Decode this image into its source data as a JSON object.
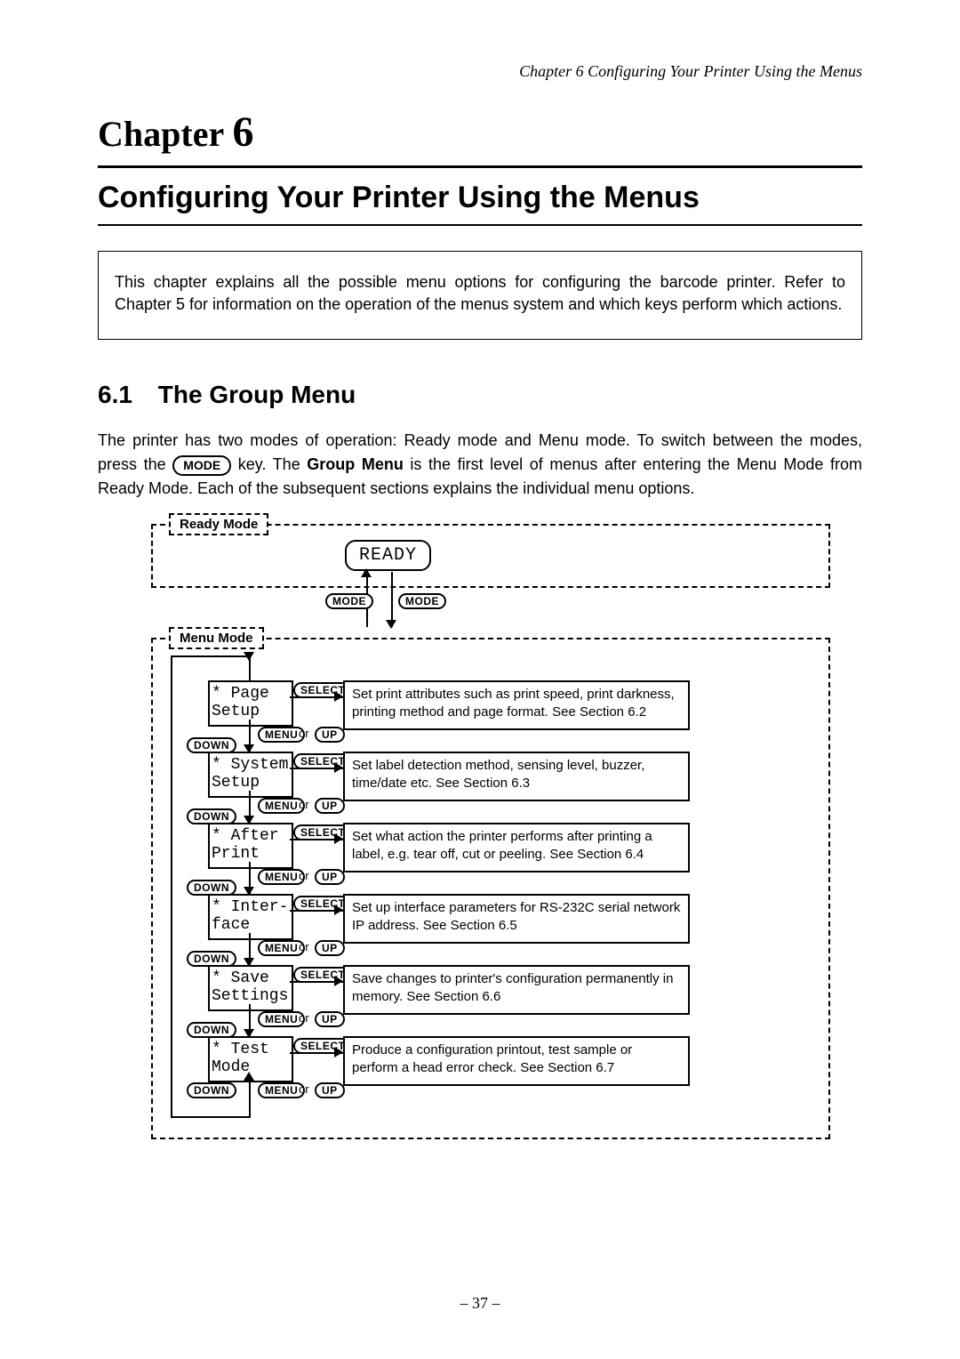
{
  "header": {
    "running_head": "Chapter 6   Configuring Your Printer Using the Menus"
  },
  "chapter": {
    "label": "Chapter",
    "number": "6",
    "title": "Configuring Your Printer Using the Menus"
  },
  "intro": {
    "text": "This chapter explains all the possible menu options for configuring the barcode printer. Refer to Chapter 5 for information on the operation of the menus system and which keys perform which actions."
  },
  "section": {
    "number": "6.1",
    "title": "The Group Menu",
    "para_a": "The printer has two modes of operation: Ready mode and Menu mode. To switch between the modes, press the ",
    "para_b_key": "MODE",
    "para_c": " key. The ",
    "para_d_bold": "Group Menu",
    "para_e": " is the first level of menus after entering the Menu Mode from Ready Mode. Each of the subsequent sections explains the individual menu options."
  },
  "diagram": {
    "ready_mode_label": "Ready Mode",
    "menu_mode_label": "Menu Mode",
    "ready_display": "READY",
    "keys": {
      "mode": "MODE",
      "select": "SELECT",
      "menu": "MENU",
      "up": "UP",
      "down": "DOWN",
      "or": "or"
    },
    "items": [
      {
        "name": "* Page Setup",
        "desc": "Set print attributes such as print speed, print darkness, printing method and page format. See Section 6.2"
      },
      {
        "name": "* System Setup",
        "desc": "Set label detection method, sensing level, buzzer, time/date etc. See Section 6.3"
      },
      {
        "name": "* After Print",
        "desc": "Set what action the printer performs after printing a label, e.g. tear off, cut or peeling.   See Section 6.4"
      },
      {
        "name": "* Inter- face",
        "desc": "Set up interface parameters for RS-232C serial network IP address. See Section 6.5"
      },
      {
        "name": "* Save Settings",
        "desc": "Save changes to printer's configuration permanently in memory. See Section 6.6"
      },
      {
        "name": "* Test Mode",
        "desc": "Produce a configuration printout, test sample or perform a head error check. See Section 6.7"
      }
    ]
  },
  "footer": {
    "page": "– 37 –"
  }
}
